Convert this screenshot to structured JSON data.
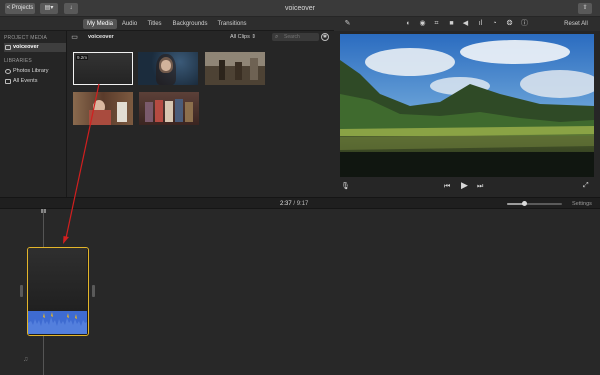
{
  "titlebar": {
    "back_label": "< Projects",
    "title": "voiceover",
    "icons": [
      "sidebar-toggle-icon",
      "import-icon",
      "share-icon"
    ]
  },
  "tabs": [
    {
      "label": "My Media",
      "active": true
    },
    {
      "label": "Audio",
      "active": false
    },
    {
      "label": "Titles",
      "active": false
    },
    {
      "label": "Backgrounds",
      "active": false
    },
    {
      "label": "Transitions",
      "active": false
    }
  ],
  "viewer_toolbar": {
    "reset_all_label": "Reset All",
    "tools": [
      "magic-wand-icon",
      "color-balance-icon",
      "color-correction-icon",
      "crop-icon",
      "stabilization-icon",
      "volume-icon",
      "noise-reduction-icon",
      "speed-icon",
      "filter-icon",
      "info-icon"
    ]
  },
  "sidebar": {
    "project_heading": "PROJECT MEDIA",
    "project_item": "voiceover",
    "libraries_heading": "LIBRARIES",
    "library_items": [
      "Photos Library",
      "All Events"
    ]
  },
  "browser": {
    "name": "voiceover",
    "filter_label": "All Clips",
    "search_placeholder": "Search",
    "thumb_badge": "9.2m"
  },
  "timeline": {
    "current_time": "2:37",
    "total_time": "9:17",
    "zoom_level": 0.3,
    "settings_label": "Settings"
  },
  "colors": {
    "accent": "#e3b52a",
    "audio_waveform": "#3e6bd1",
    "annotation_arrow": "#d11f1f"
  }
}
